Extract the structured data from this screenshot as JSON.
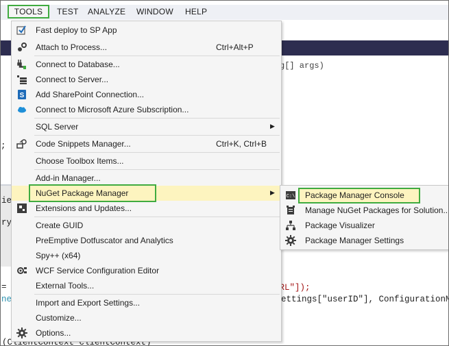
{
  "menubar": {
    "items": [
      "TOOLS",
      "TEST",
      "ANALYZE",
      "WINDOW",
      "HELP"
    ]
  },
  "editor": {
    "header_hint": "g[] args)",
    "code_line_1": "URL\"]);",
    "code_line_2": "ettings[\"userID\"], ConfigurationMan",
    "code_line_3": "(ClientContext clientContext)",
    "left_fragment_1": "ie",
    "left_fragment_2": "ry",
    "left_fragment_3": ";",
    "left_fragment_4": "=",
    "left_fragment_5": "ne"
  },
  "tools_menu": {
    "items": [
      {
        "label": "Fast deploy to SP App",
        "shortcut": "",
        "icon": "deploy-icon"
      },
      {
        "label": "Attach to Process...",
        "shortcut": "Ctrl+Alt+P",
        "icon": "attach-icon"
      },
      {
        "label": "Connect to Database...",
        "shortcut": "",
        "icon": "database-connect-icon"
      },
      {
        "label": "Connect to Server...",
        "shortcut": "",
        "icon": "server-connect-icon"
      },
      {
        "label": "Add SharePoint Connection...",
        "shortcut": "",
        "icon": "sharepoint-icon"
      },
      {
        "label": "Connect to Microsoft Azure Subscription...",
        "shortcut": "",
        "icon": "azure-cloud-icon"
      },
      {
        "label": "SQL Server",
        "shortcut": "",
        "icon": ""
      },
      {
        "label": "Code Snippets Manager...",
        "shortcut": "Ctrl+K, Ctrl+B",
        "icon": "snippets-icon"
      },
      {
        "label": "Choose Toolbox Items...",
        "shortcut": "",
        "icon": ""
      },
      {
        "label": "Add-in Manager...",
        "shortcut": "",
        "icon": ""
      },
      {
        "label": "NuGet Package Manager",
        "shortcut": "",
        "icon": ""
      },
      {
        "label": "Extensions and Updates...",
        "shortcut": "",
        "icon": "extensions-icon"
      },
      {
        "label": "Create GUID",
        "shortcut": "",
        "icon": ""
      },
      {
        "label": "PreEmptive Dotfuscator and Analytics",
        "shortcut": "",
        "icon": ""
      },
      {
        "label": "Spy++ (x64)",
        "shortcut": "",
        "icon": ""
      },
      {
        "label": "WCF Service Configuration Editor",
        "shortcut": "",
        "icon": "wcf-config-icon"
      },
      {
        "label": "External Tools...",
        "shortcut": "",
        "icon": ""
      },
      {
        "label": "Import and Export Settings...",
        "shortcut": "",
        "icon": ""
      },
      {
        "label": "Customize...",
        "shortcut": "",
        "icon": ""
      },
      {
        "label": "Options...",
        "shortcut": "",
        "icon": "gear-icon"
      }
    ]
  },
  "nuget_submenu": {
    "items": [
      {
        "label": "Package Manager Console",
        "icon": "console-icon"
      },
      {
        "label": "Manage NuGet Packages for Solution...",
        "icon": "nuget-packages-icon"
      },
      {
        "label": "Package Visualizer",
        "icon": "visualizer-icon"
      },
      {
        "label": "Package Manager Settings",
        "icon": "gear-icon"
      }
    ]
  },
  "colors": {
    "highlight_border": "#3fab3f",
    "hover_fill": "#fdf4bf",
    "menu_bg": "#f5f5f5"
  }
}
